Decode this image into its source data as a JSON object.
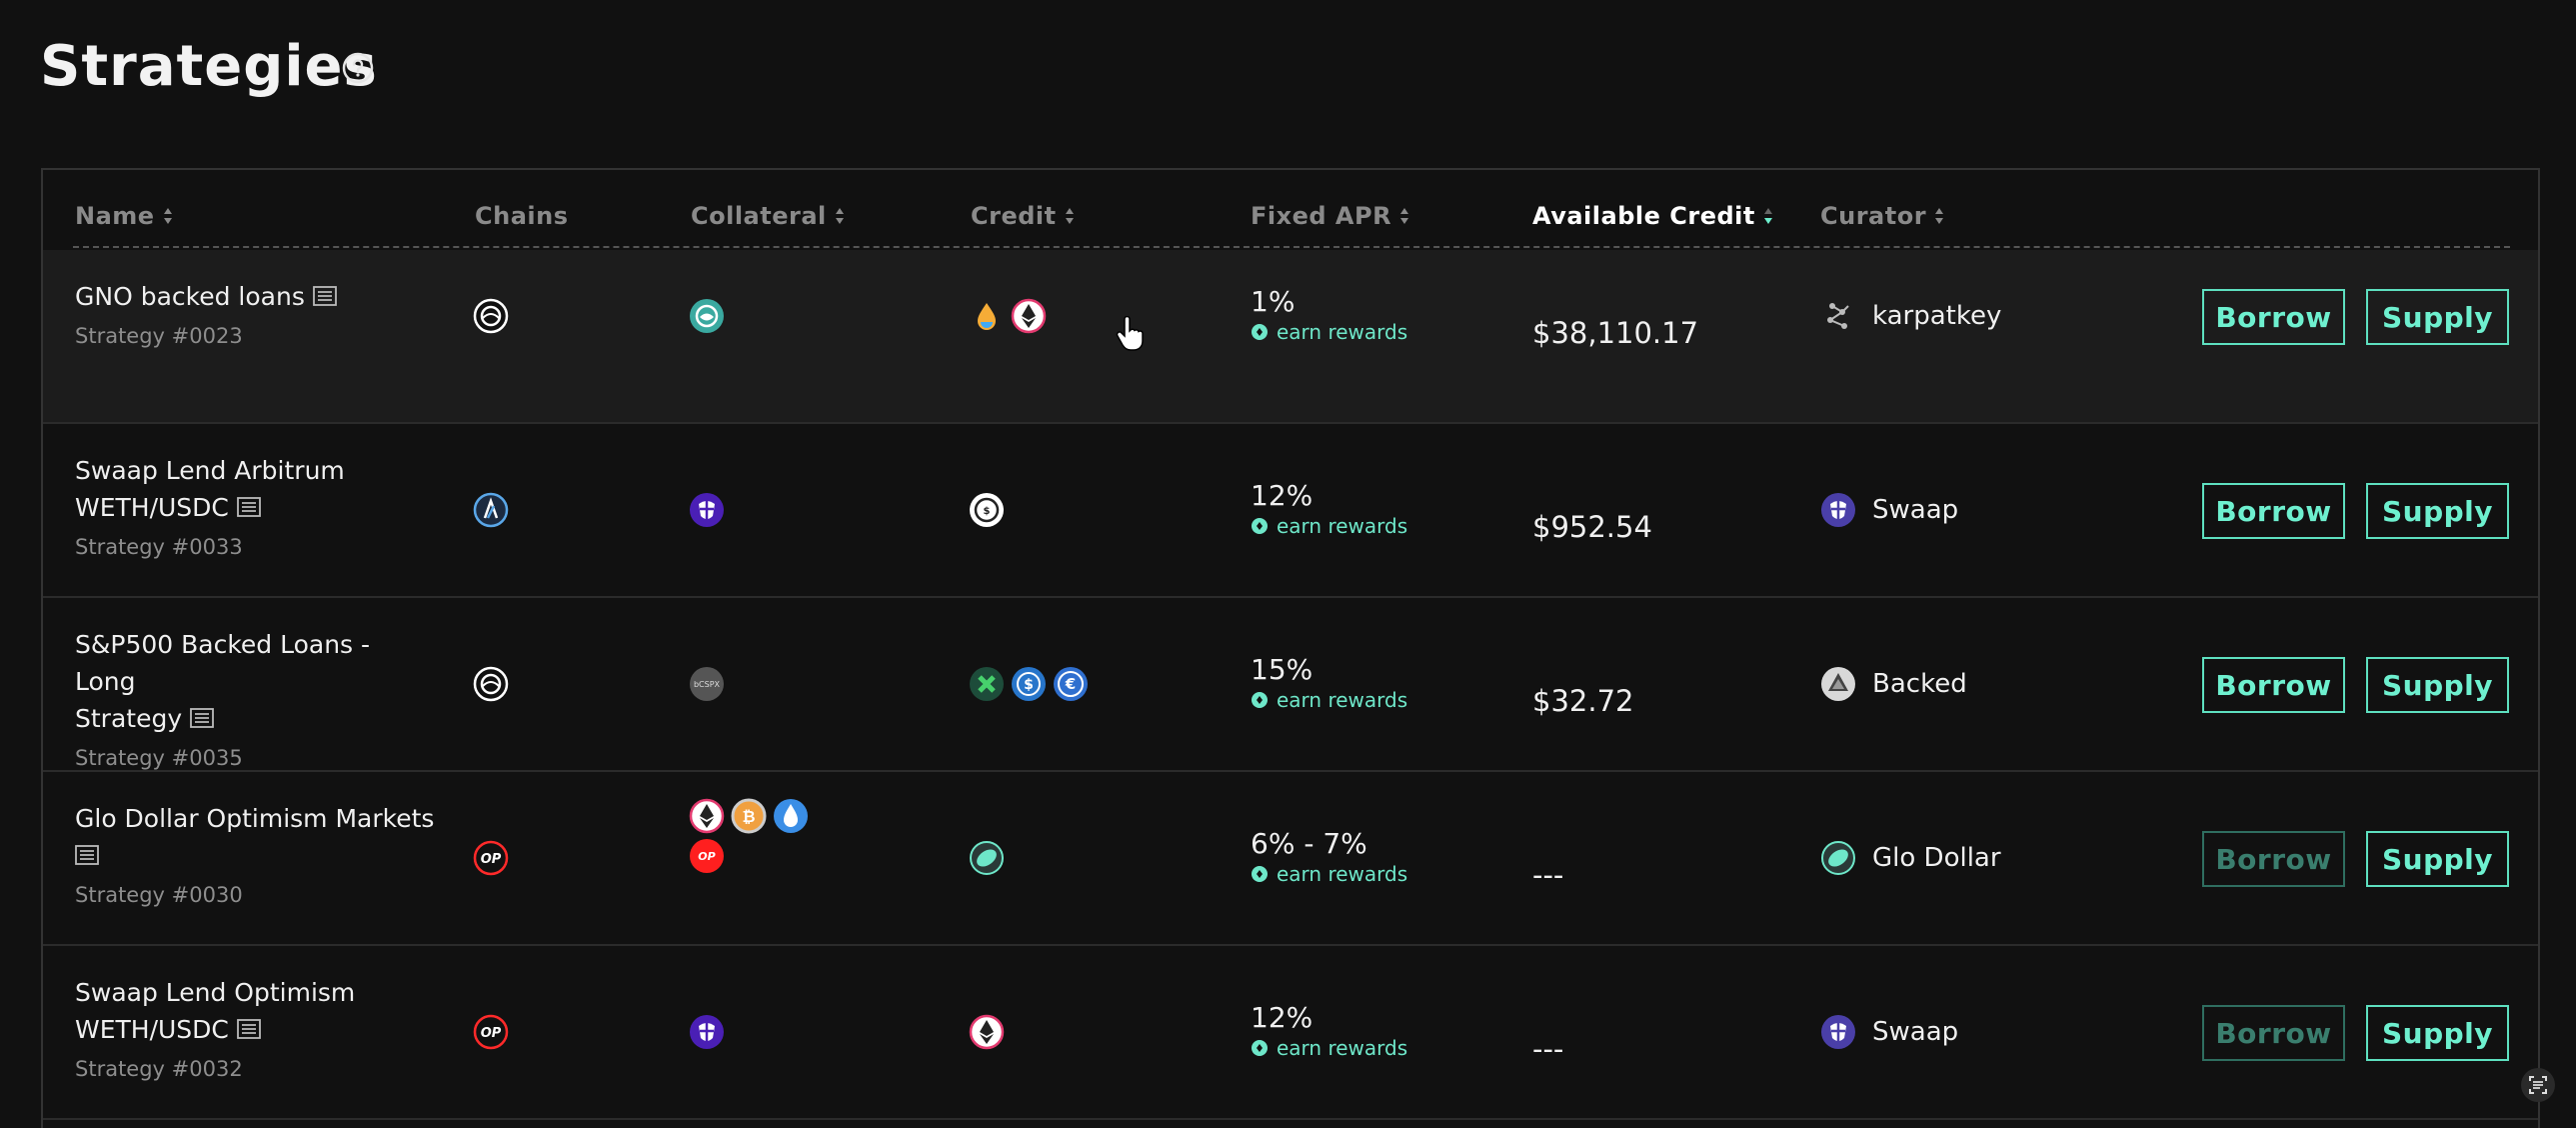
{
  "page": {
    "title": "Strategies"
  },
  "table": {
    "columns": {
      "name": "Name",
      "chains": "Chains",
      "collateral": "Collateral",
      "credit": "Credit",
      "apr": "Fixed APR",
      "available": "Available Credit",
      "curator": "Curator"
    },
    "earn_label": "earn rewards",
    "borrow_label": "Borrow",
    "supply_label": "Supply",
    "rows": [
      {
        "name": "GNO backed loans",
        "strategy_id": "Strategy #0023",
        "chain_icon": "gnosis-icon",
        "collateral_icons": [
          "gno-icon"
        ],
        "credit_icons": [
          "sdai-icon",
          "eth-icon"
        ],
        "apr": "1%",
        "available": "$38,110.17",
        "curator": "karpatkey",
        "curator_icon": "karpatkey-icon",
        "borrow_enabled": true
      },
      {
        "name_line1": "Swaap Lend Arbitrum",
        "name_line2": "WETH/USDC",
        "strategy_id": "Strategy #0033",
        "chain_icon": "arbitrum-icon",
        "collateral_icons": [
          "swaap-icon"
        ],
        "credit_icons": [
          "usdc-icon"
        ],
        "apr": "12%",
        "available": "$952.54",
        "curator": "Swaap",
        "curator_icon": "swaap-icon",
        "borrow_enabled": true
      },
      {
        "name_line1": "S&P500 Backed Loans - Long",
        "name_line2": "Strategy",
        "strategy_id": "Strategy #0035",
        "chain_icon": "gnosis-icon",
        "collateral_icons": [
          "bcspx-icon"
        ],
        "collateral_text": "bCSPX",
        "credit_icons": [
          "xdai-icon",
          "usdc-icon",
          "eure-icon"
        ],
        "apr": "15%",
        "available": "$32.72",
        "curator": "Backed",
        "curator_icon": "backed-icon",
        "borrow_enabled": true
      },
      {
        "name_line1": "Glo Dollar Optimism Markets",
        "strategy_id": "Strategy #0030",
        "chain_icon": "optimism-icon",
        "chain_text": "OP",
        "collateral_icons": [
          "eth-icon",
          "btc-icon",
          "wsteth-icon",
          "op-icon"
        ],
        "credit_icons": [
          "glo-icon"
        ],
        "apr": "6% - 7%",
        "available": "---",
        "curator": "Glo Dollar",
        "curator_icon": "glo-icon",
        "borrow_enabled": false
      },
      {
        "name_line1": "Swaap Lend Optimism",
        "name_line2": "WETH/USDC",
        "strategy_id": "Strategy #0032",
        "chain_icon": "optimism-icon",
        "chain_text": "OP",
        "collateral_icons": [
          "swaap-icon"
        ],
        "credit_icons": [
          "eth-icon"
        ],
        "apr": "12%",
        "available": "---",
        "curator": "Swaap",
        "curator_icon": "swaap-icon",
        "borrow_enabled": false
      }
    ]
  },
  "colors": {
    "accent": "#6ef0cf",
    "background": "#111111",
    "row_highlight": "#1c1c1c"
  }
}
